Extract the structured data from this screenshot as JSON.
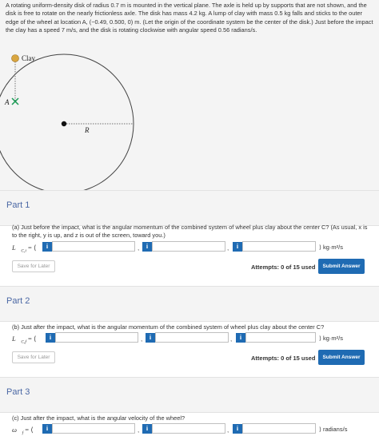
{
  "problem": {
    "text": "A rotating uniform-density disk of radius 0.7 m is mounted in the vertical plane. The axle is held up by supports that are not shown, and the disk is free to rotate on the nearly frictionless axle. The disk has mass 4.2 kg. A lump of clay with mass 0.5 kg falls and sticks to the outer edge of the wheel at location A, (−0.49, 0.500, 0) m. (Let the origin of the coordinate system be the center of the disk.) Just before the impact the clay has a speed 7 m/s, and the disk is rotating clockwise with angular speed 0.56 radians/s."
  },
  "figure": {
    "clay_label": "Clay",
    "a_label": "A",
    "r_label": "R"
  },
  "parts": [
    {
      "title": "Part 1",
      "question": "(a) Just before the impact, what is the angular momentum of the combined system of wheel plus clay about the center C? (As usual, x is to the right, y is up, and z is out of the screen, toward you.)",
      "vector_label": "L⃗",
      "vector_sub": "C,i",
      "open": "= ⟨",
      "unit": "⟩ kg·m²/s",
      "save": "Save for Later",
      "attempts": "Attempts: 0 of 15 used",
      "submit": "Submit Answer"
    },
    {
      "title": "Part 2",
      "question": "(b) Just after the impact, what is the angular momentum of the combined system of wheel plus clay about the center C?",
      "vector_label": "L⃗",
      "vector_sub": "C,f",
      "open": "= ⟨",
      "unit": "⟩ kg·m²/s",
      "save": "Save for Later",
      "attempts": "Attempts: 0 of 15 used",
      "submit": "Submit Answer"
    },
    {
      "title": "Part 3",
      "question": "(c) Just after the impact, what is the angular velocity of the wheel?",
      "vector_label": "ω⃗",
      "vector_sub": "f",
      "open": "= ⟨",
      "unit": "⟩ radians/s"
    }
  ],
  "info_glyph": "i",
  "comma": ","
}
